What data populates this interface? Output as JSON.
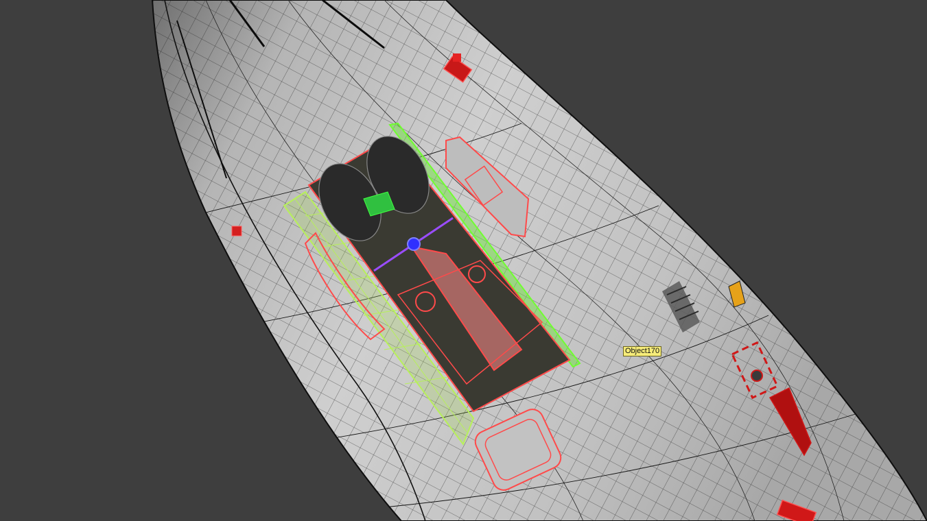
{
  "viewport": {
    "background_color": "#3e3e3e",
    "fuselage_color": "#c9c9c9",
    "wireframe_color": "#1a1a1a",
    "selection_color": "#ff4a4a",
    "door_color": "#b7f05a",
    "gizmo_color": "#9a4dff"
  },
  "hover_tooltip": {
    "label": "Object170",
    "background_color": "#f6ec79"
  },
  "objects": {
    "fuselage": "aircraft-fuselage-mesh",
    "landing_gear": "main-landing-gear-selected",
    "gear_door": "gear-door-panel",
    "access_panel": "access-hatch-panel",
    "antenna_fairing": "antenna-fairing",
    "warning_marker": "warning-stripe-marker"
  }
}
